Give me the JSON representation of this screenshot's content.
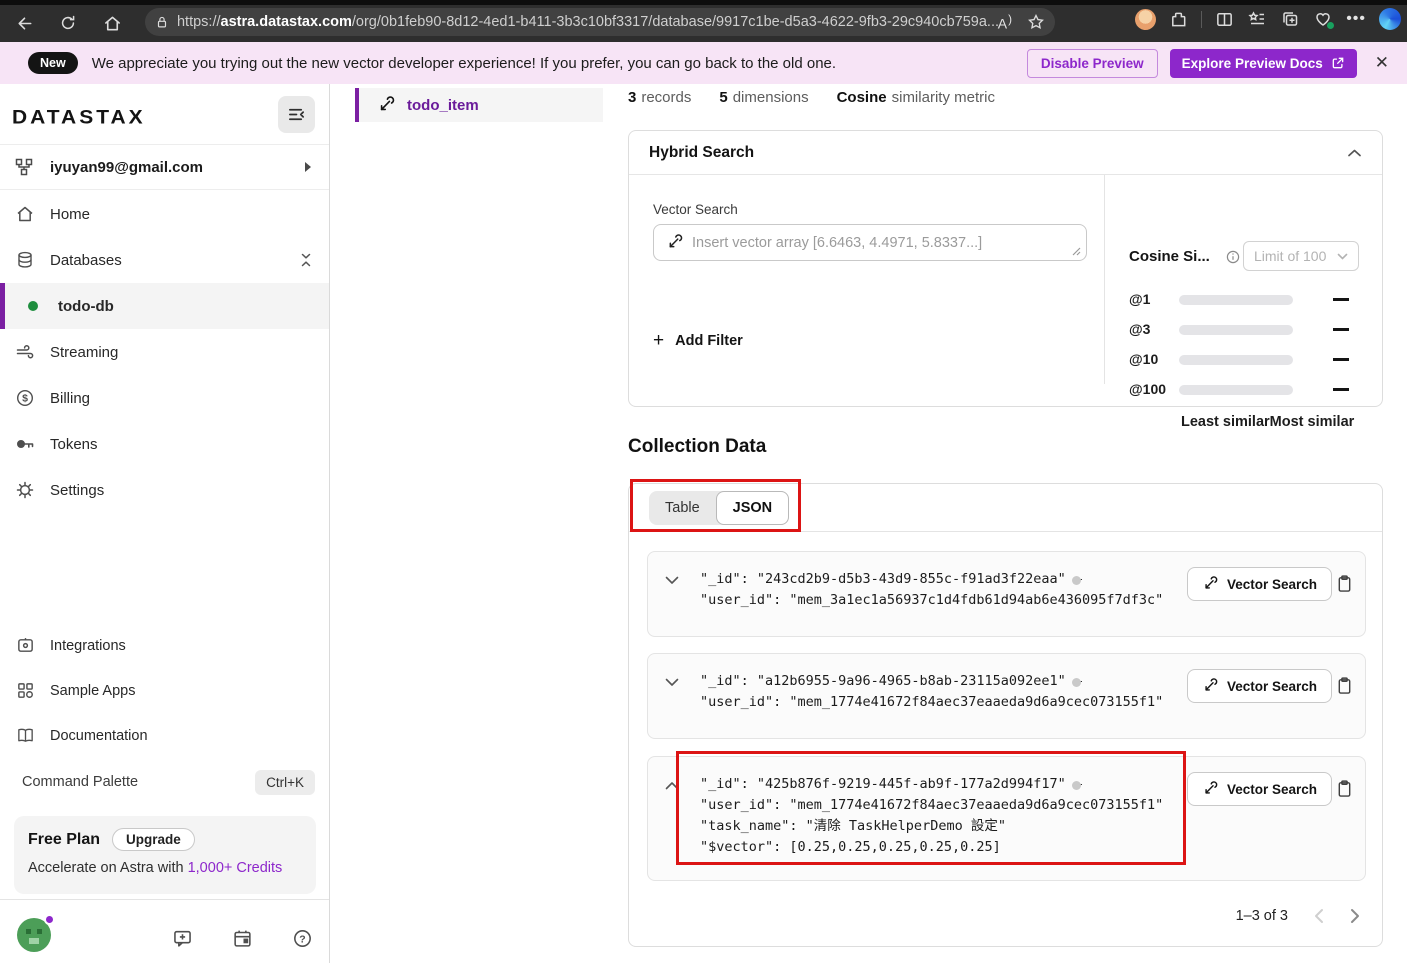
{
  "browser": {
    "url_prefix": "https://",
    "url_domain": "astra.datastax.com",
    "url_path": "/org/0b1feb90-8d12-4ed1-b411-3b3c10bf3317/database/9917c1be-d5a3-4622-9fb3-29c940cb759a..."
  },
  "banner": {
    "badge": "New",
    "message": "We appreciate you trying out the new vector developer experience! If you prefer, you can go back to the old one.",
    "disable_button": "Disable Preview",
    "explore_button": "Explore Preview Docs"
  },
  "sidebar": {
    "logo": "DATASTAX",
    "org_email": "iyuyan99@gmail.com",
    "nav": [
      {
        "label": "Home"
      },
      {
        "label": "Databases"
      },
      {
        "label": "todo-db"
      },
      {
        "label": "Streaming"
      },
      {
        "label": "Billing"
      },
      {
        "label": "Tokens"
      },
      {
        "label": "Settings"
      }
    ],
    "nav2": [
      {
        "label": "Integrations"
      },
      {
        "label": "Sample Apps"
      },
      {
        "label": "Documentation"
      }
    ],
    "command_palette": {
      "label": "Command Palette",
      "shortcut": "Ctrl+K"
    },
    "plan": {
      "name": "Free Plan",
      "upgrade": "Upgrade",
      "line": "Accelerate on Astra with",
      "credits": "1,000+ Credits"
    }
  },
  "collection": {
    "tab": "todo_item",
    "stats": [
      {
        "value": "3",
        "label": "records"
      },
      {
        "value": "5",
        "label": "dimensions"
      },
      {
        "value": "Cosine",
        "label": "similarity metric"
      }
    ]
  },
  "hybrid_search": {
    "title": "Hybrid Search",
    "vector_label": "Vector Search",
    "placeholder": "Insert vector array [6.6463, 4.4971, 5.8337...]",
    "add_filter": "Add Filter",
    "metric": "Cosine Si...",
    "limit": "Limit of 100",
    "at_rows": [
      "@1",
      "@3",
      "@10",
      "@100"
    ],
    "least": "Least similar",
    "most": "Most similar"
  },
  "collection_data": {
    "title": "Collection Data",
    "toggle": {
      "table": "Table",
      "json": "JSON"
    },
    "record_action": "Vector Search",
    "records": [
      {
        "lines": [
          "\"_id\": \"243cd2b9-d5b3-43d9-855c-f91ad3f22eaa\" —",
          "\"user_id\": \"mem_3a1ec1a56937c1d4fdb61d94ab6e436095f7df3c\""
        ]
      },
      {
        "lines": [
          "\"_id\": \"a12b6955-9a96-4965-b8ab-23115a092ee1\" —",
          "\"user_id\": \"mem_1774e41672f84aec37eaaeda9d6a9cec073155f1\""
        ]
      },
      {
        "lines": [
          "\"_id\": \"425b876f-9219-445f-ab9f-177a2d994f17\" —",
          "\"user_id\": \"mem_1774e41672f84aec37eaaeda9d6a9cec073155f1\"",
          "\"task_name\": \"清除 TaskHelperDemo 設定\"",
          "\"$vector\": [0.25,0.25,0.25,0.25,0.25]"
        ]
      }
    ],
    "pagination": "1–3 of 3"
  },
  "colors": {
    "accent_purple": "#8d27cb",
    "selected_bar_purple": "#7b1fa2",
    "banner_background": "#f7e4f6",
    "status_green": "#1e8e3e",
    "annotation_red": "#dc1414"
  }
}
